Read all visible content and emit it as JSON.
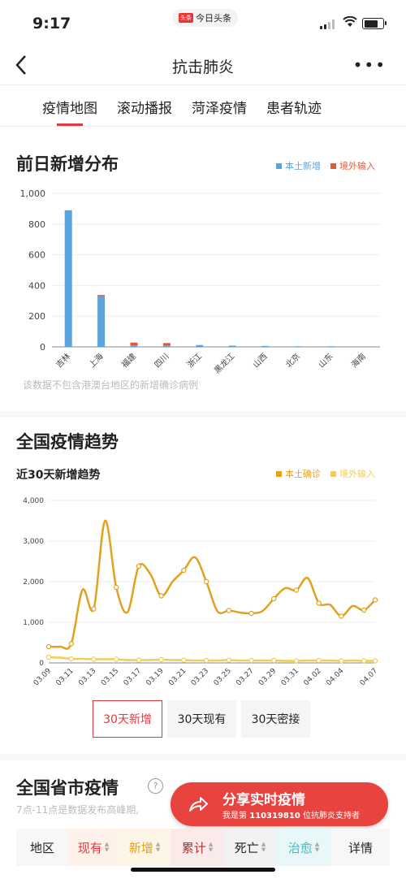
{
  "status": {
    "time": "9:17",
    "app_logo": "头条",
    "app_name": "今日头条"
  },
  "nav": {
    "title": "抗击肺炎",
    "back_icon": "back-chevron-icon",
    "more_icon": "more-dots-icon"
  },
  "tabs": [
    {
      "label": "疫情地图",
      "active": true
    },
    {
      "label": "滚动播报",
      "active": false
    },
    {
      "label": "菏泽疫情",
      "active": false
    },
    {
      "label": "患者轨迹",
      "active": false
    }
  ],
  "section1": {
    "title": "前日新增分布",
    "legend": [
      "本土新增",
      "境外输入"
    ],
    "note": "该数据不包含港澳台地区的新增确诊病例"
  },
  "section2": {
    "title": "全国疫情趋势",
    "subtitle": "近30天新增趋势",
    "legend": [
      "本土确诊",
      "境外输入"
    ]
  },
  "colors": {
    "accent": "#e4393c",
    "local_bar": "#5aa3dc",
    "import_bar": "#dd5a3d",
    "local_line": "#e2a21f",
    "import_line": "#f3cc55"
  },
  "buttons": [
    {
      "label": "30天新增",
      "active": true
    },
    {
      "label": "30天现有",
      "active": false
    },
    {
      "label": "30天密接",
      "active": false
    }
  ],
  "section3": {
    "title": "全国省市疫情",
    "hint": "7点-11点是数据发布高峰期,",
    "help_icon": "question-icon"
  },
  "share": {
    "main": "分享实时疫情",
    "sub_prefix": "我是第 ",
    "number": "110319810",
    "sub_suffix": " 位抗肺炎支持者",
    "icon": "share-arrow-icon"
  },
  "table_header": [
    {
      "label": "地区",
      "color": "#222222",
      "sort": false,
      "bg": "#f7f7f7"
    },
    {
      "label": "现有",
      "color": "#e4393c",
      "sort": true,
      "bg": "#fdf1ea"
    },
    {
      "label": "新增",
      "color": "#e2a21f",
      "sort": true,
      "bg": "#fdf6e6"
    },
    {
      "label": "累计",
      "color": "#b8302c",
      "sort": true,
      "bg": "#fbeaea"
    },
    {
      "label": "死亡",
      "color": "#222222",
      "sort": true,
      "bg": "#f2f2f2"
    },
    {
      "label": "治愈",
      "color": "#43b9c0",
      "sort": true,
      "bg": "#e8f7f7"
    },
    {
      "label": "详情",
      "color": "#222222",
      "sort": false,
      "bg": "#f7f7f7"
    }
  ],
  "chart_data": [
    {
      "type": "bar",
      "categories": [
        "吉林",
        "上海",
        "福建",
        "四川",
        "浙江",
        "黑龙江",
        "山西",
        "北京",
        "山东",
        "海南"
      ],
      "series": [
        {
          "name": "本土新增",
          "values": [
            890,
            330,
            10,
            10,
            12,
            8,
            6,
            4,
            4,
            3
          ]
        },
        {
          "name": "境外输入",
          "values": [
            0,
            8,
            18,
            15,
            0,
            0,
            0,
            0,
            0,
            0
          ]
        }
      ],
      "yticks": [
        "0",
        "200",
        "400",
        "600",
        "800",
        "1,000"
      ],
      "ylim": [
        0,
        1000
      ],
      "grid": true
    },
    {
      "type": "line",
      "x": [
        "03.09",
        "03.10",
        "03.11",
        "03.12",
        "03.13",
        "03.14",
        "03.15",
        "03.16",
        "03.17",
        "03.18",
        "03.19",
        "03.20",
        "03.21",
        "03.22",
        "03.23",
        "03.24",
        "03.25",
        "03.26",
        "03.27",
        "03.28",
        "03.29",
        "03.30",
        "03.31",
        "04.01",
        "04.02",
        "04.03",
        "04.04",
        "04.05",
        "04.06",
        "04.07"
      ],
      "xticks": [
        "03.09",
        "03.11",
        "03.13",
        "03.15",
        "03.17",
        "03.19",
        "03.21",
        "03.23",
        "03.25",
        "03.27",
        "03.29",
        "03.31",
        "04.02",
        "04.04",
        "04.07"
      ],
      "series": [
        {
          "name": "本土确诊",
          "values": [
            400,
            400,
            470,
            1800,
            1330,
            3500,
            1860,
            1250,
            2380,
            2200,
            1650,
            2000,
            2280,
            2600,
            2000,
            1270,
            1290,
            1240,
            1220,
            1280,
            1580,
            1840,
            1790,
            2090,
            1470,
            1430,
            1150,
            1400,
            1300,
            1550
          ]
        },
        {
          "name": "境外输入",
          "values": [
            140,
            130,
            100,
            100,
            90,
            90,
            90,
            70,
            70,
            70,
            80,
            70,
            70,
            60,
            60,
            60,
            70,
            60,
            60,
            60,
            60,
            50,
            50,
            60,
            60,
            60,
            50,
            60,
            50,
            50
          ]
        }
      ],
      "yticks": [
        "0",
        "1,000",
        "2,000",
        "3,000",
        "4,000"
      ],
      "ylim": [
        0,
        4000
      ],
      "grid": true
    }
  ]
}
